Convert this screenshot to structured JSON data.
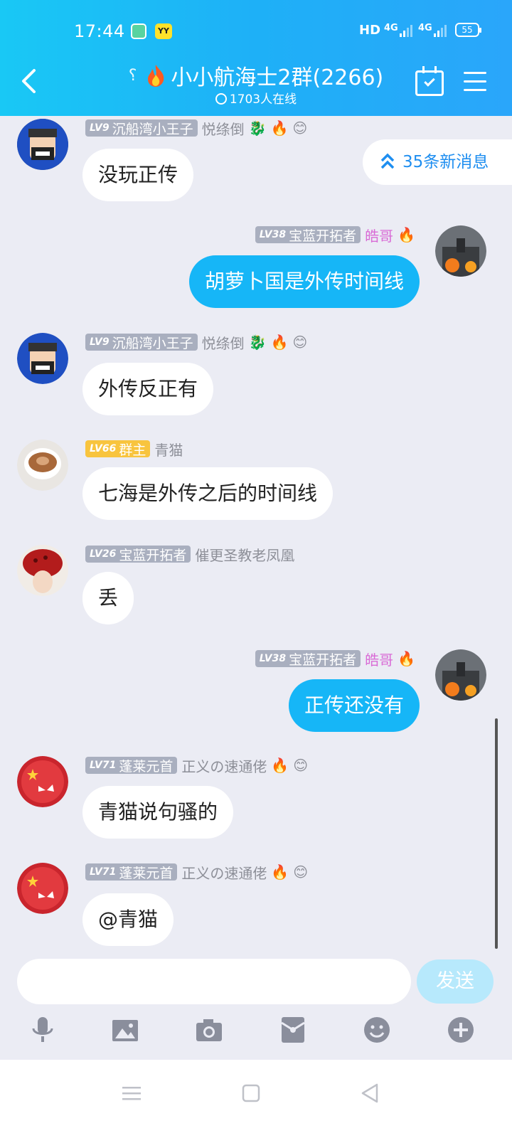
{
  "status_bar": {
    "time": "17:44",
    "app_badge": "YY",
    "network": "HD",
    "signal1": "4G",
    "signal2": "4G",
    "battery": "55"
  },
  "header": {
    "title": "小小航海士2群(2266)",
    "online": "1703人在线"
  },
  "new_messages": "35条新消息",
  "messages": [
    {
      "level": "LV9",
      "badge": "沉船湾小王子",
      "name": "悦绦倒",
      "text": "没玩正传",
      "side": "in"
    },
    {
      "level": "LV38",
      "badge": "宝蓝开拓者",
      "name": "皓哥",
      "text": "胡萝卜国是外传时间线",
      "side": "out"
    },
    {
      "level": "LV9",
      "badge": "沉船湾小王子",
      "name": "悦绦倒",
      "text": "外传反正有",
      "side": "in"
    },
    {
      "level": "LV66",
      "badge": "群主",
      "name": "青猫",
      "text": "七海是外传之后的时间线",
      "side": "in"
    },
    {
      "level": "LV26",
      "badge": "宝蓝开拓者",
      "name": "催更圣教老凤凰",
      "text": "丢",
      "side": "in"
    },
    {
      "level": "LV38",
      "badge": "宝蓝开拓者",
      "name": "皓哥",
      "text": "正传还没有",
      "side": "out"
    },
    {
      "level": "LV71",
      "badge": "蓬莱元首",
      "name": "正义の速通佬",
      "text": "青猫说句骚的",
      "side": "in"
    },
    {
      "level": "LV71",
      "badge": "蓬莱元首",
      "name": "正义の速通佬",
      "text": "@青猫",
      "side": "in"
    }
  ],
  "input": {
    "placeholder": ""
  },
  "send_label": "发送",
  "colors": {
    "header": "#1eb0f7",
    "out_bubble": "#16b6f7",
    "gold_badge": "#f8c43e"
  },
  "toolbar_icons": [
    "microphone-icon",
    "image-icon",
    "camera-icon",
    "red-packet-icon",
    "emoji-icon",
    "plus-icon"
  ],
  "nav_icons": [
    "menu-nav-icon",
    "home-nav-icon",
    "back-nav-icon"
  ]
}
